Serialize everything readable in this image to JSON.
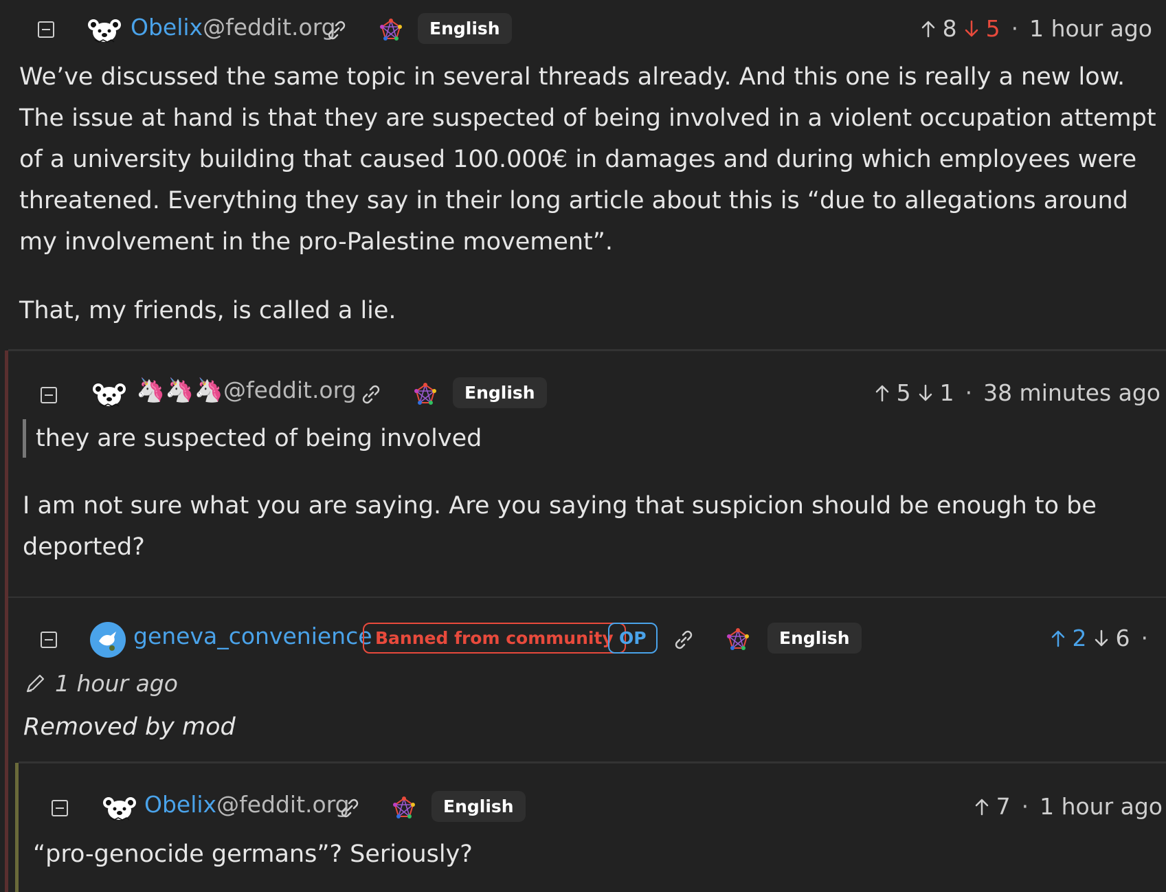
{
  "comment1": {
    "username": "Obelix",
    "instance": "@feddit.org",
    "language": "English",
    "upvotes": "8",
    "downvotes": "5",
    "time": "1 hour ago",
    "paragraphs": [
      "We’ve discussed the same topic in several threads already. And this one is really a new low. The issue at hand is that they are suspected of being involved in a violent occupation attempt of a university building that caused 100.000€ in damages and during which employees were threatened. Everything they say in their long article about this is “due to allegations around my involvement in the pro-Palestine movement”.",
      "That, my friends, is called a lie."
    ]
  },
  "comment2": {
    "username_emoji": "🦄🦄🦄",
    "instance": "@feddit.org",
    "language": "English",
    "upvotes": "5",
    "downvotes": "1",
    "time": "38 minutes ago",
    "quote": "they are suspected of being involved",
    "paragraph": "I am not sure what you are saying. Are you saying that suspicion should be enough to be deported?"
  },
  "comment3": {
    "username": "geneva_convenience",
    "banned_badge": "Banned from community",
    "op_badge": "OP",
    "language": "English",
    "upvotes": "2",
    "downvotes": "6",
    "time": "1 hour ago",
    "removed_text": "Removed by mod"
  },
  "comment4": {
    "username": "Obelix",
    "instance": "@feddit.org",
    "language": "English",
    "upvotes": "7",
    "time": "1 hour ago",
    "paragraph": "“pro-genocide germans”? Seriously?"
  },
  "colors": {
    "background": "#222222",
    "link_blue": "#4aa3ea",
    "downvote_red": "#e84a3c",
    "thread_line_red": "#5a2f2f",
    "thread_line_olive": "#6a6a3a"
  },
  "icons": {
    "collapse": "collapse-minus-icon",
    "avatar": "bear-avatar-icon",
    "link": "link-icon",
    "federation": "fediverse-icon",
    "upvote": "arrow-up-icon",
    "downvote": "arrow-down-icon",
    "edit": "pencil-icon"
  }
}
